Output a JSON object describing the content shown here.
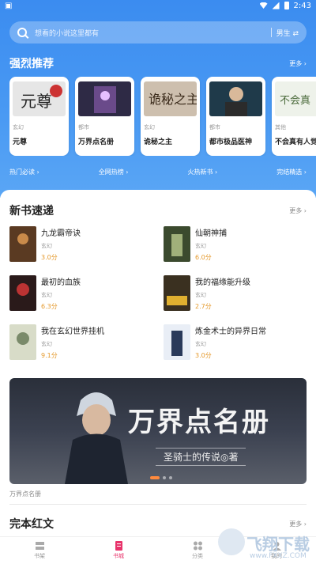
{
  "status_bar": {
    "time": "2:43"
  },
  "search": {
    "placeholder": "想看的小说这里都有",
    "gender_label": "男生 ⇄"
  },
  "strong_recommend": {
    "title": "强烈推荐",
    "more": "更多 ›",
    "books": [
      {
        "genre": "玄幻",
        "title": "元尊"
      },
      {
        "genre": "都市",
        "title": "万界点名册"
      },
      {
        "genre": "玄幻",
        "title": "诡秘之主"
      },
      {
        "genre": "都市",
        "title": "都市极品医神"
      },
      {
        "genre": "其他",
        "title": "不会真有人觉"
      }
    ]
  },
  "quick_links": [
    "热门必读 ›",
    "全网热榜 ›",
    "火热新书 ›",
    "完结精选 ›"
  ],
  "new_books": {
    "title": "新书速递",
    "more": "更多 ›",
    "items": [
      {
        "title": "九龙霸帝诀",
        "genre": "玄幻",
        "score": "3.0分"
      },
      {
        "title": "仙朝神捕",
        "genre": "玄幻",
        "score": "6.0分"
      },
      {
        "title": "最初的血族",
        "genre": "玄幻",
        "score": "6.3分"
      },
      {
        "title": "我的福缘能升级",
        "genre": "玄幻",
        "score": "2.7分"
      },
      {
        "title": "我在玄幻世界挂机",
        "genre": "玄幻",
        "score": "9.1分"
      },
      {
        "title": "炼金术士的异界日常",
        "genre": "玄幻",
        "score": "3.0分"
      }
    ]
  },
  "banner": {
    "title": "万界点名册",
    "subtitle": "圣骑士的传说◎著",
    "caption": "万界点名册"
  },
  "finished": {
    "title": "完本红文",
    "more": "更多 ›"
  },
  "tabs": [
    {
      "label": "书架",
      "active": false
    },
    {
      "label": "书城",
      "active": true
    },
    {
      "label": "分类",
      "active": false
    },
    {
      "label": "我的",
      "active": false
    }
  ],
  "watermark": {
    "text": "飞翔下载",
    "url": "www.FXXZ.COM"
  },
  "colors": {
    "primary_blue": "#3b8cf0",
    "active_tab": "#e8336b",
    "score": "#e59a2d"
  }
}
